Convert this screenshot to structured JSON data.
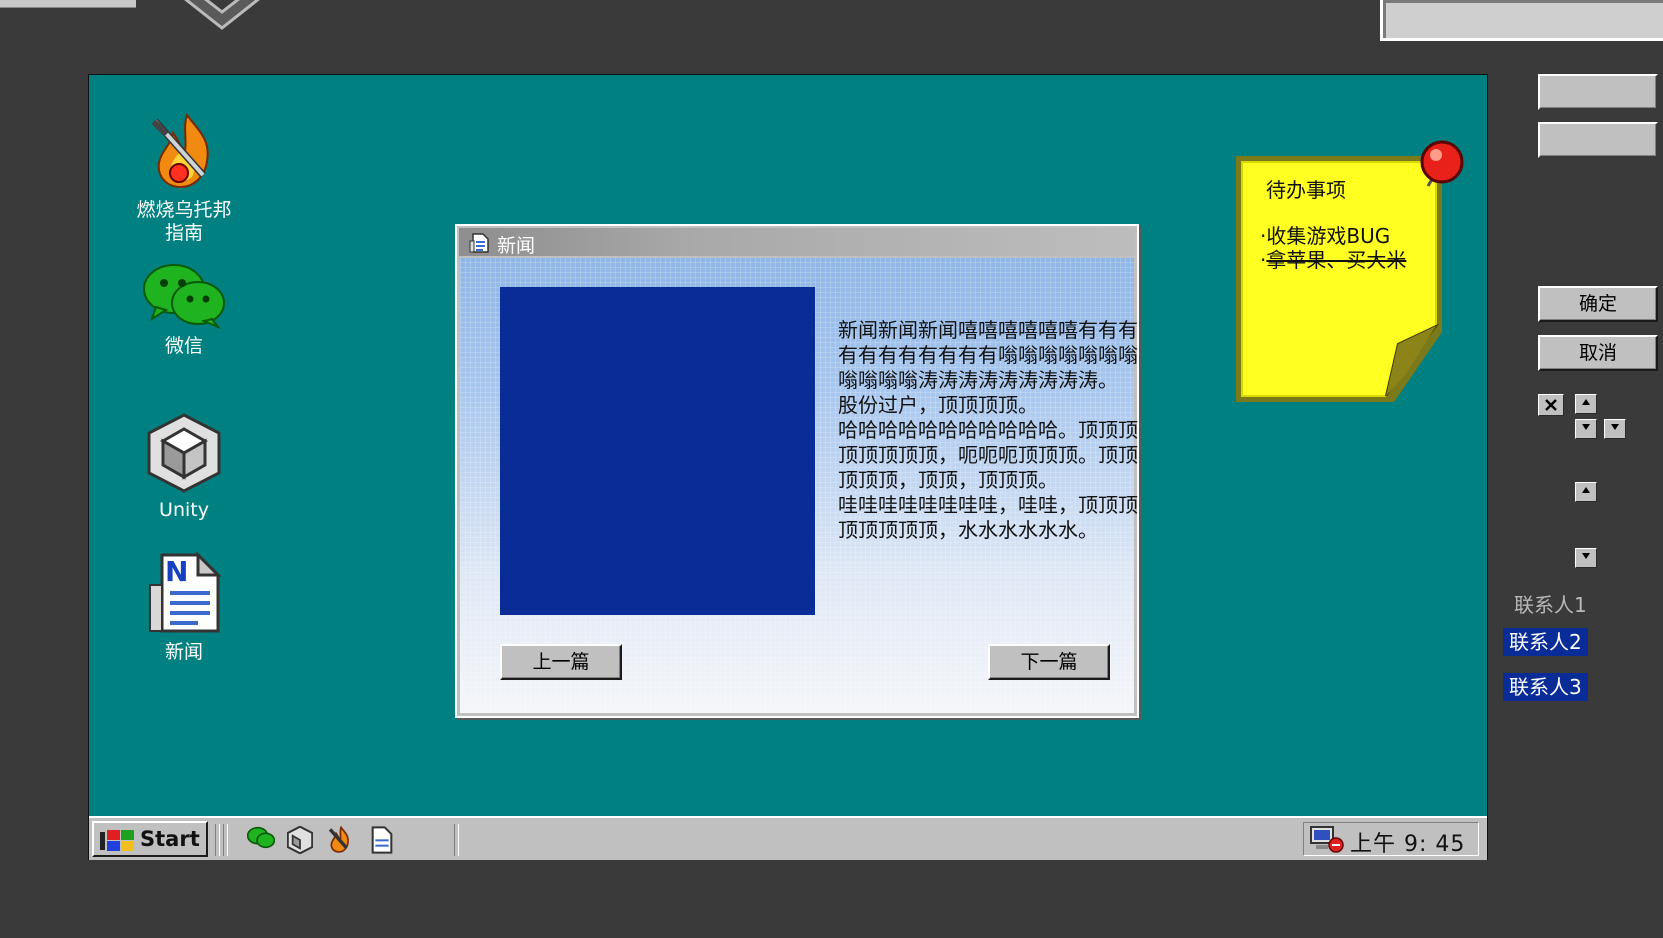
{
  "desktop": {
    "icons": [
      {
        "label_line1": "燃烧乌托邦",
        "label_line2": "指南",
        "icon": "burning-sword-icon"
      },
      {
        "label": "微信",
        "icon": "wechat-icon"
      },
      {
        "label": "Unity",
        "icon": "unity-icon"
      },
      {
        "label": "新闻",
        "icon": "news-document-icon"
      }
    ]
  },
  "news_window": {
    "title": "新闻",
    "paragraphs": [
      "新闻新闻新闻嘻嘻嘻嘻嘻嘻有有有有有有有有有有有嗡嗡嗡嗡嗡嗡嗡嗡嗡嗡嗡涛涛涛涛涛涛涛涛涛。",
      "股份过户，顶顶顶顶。",
      "哈哈哈哈哈哈哈哈哈哈哈。顶顶顶顶顶顶顶顶，呃呃呃顶顶顶。顶顶顶顶顶，顶顶，顶顶顶。",
      "哇哇哇哇哇哇哇哇，哇哇，顶顶顶顶顶顶顶顶，水水水水水水。"
    ],
    "prev_label": "上一篇",
    "next_label": "下一篇",
    "image_color": "#0a2c97"
  },
  "sticky_note": {
    "title": "待办事项",
    "items": [
      {
        "text": "收集游戏BUG",
        "done": false
      },
      {
        "text": "拿苹果、买大米",
        "done": true
      }
    ]
  },
  "taskbar": {
    "start_label": "Start",
    "pinned": [
      "wechat-icon",
      "unity-icon",
      "burning-sword-icon",
      "news-document-icon"
    ],
    "clock": "上午 9: 45"
  },
  "right_panel": {
    "confirm_label": "确定",
    "cancel_label": "取消",
    "contacts": [
      {
        "label": "联系人1",
        "selected": false
      },
      {
        "label": "联系人2",
        "selected": true
      },
      {
        "label": "联系人3",
        "selected": true
      }
    ]
  },
  "colors": {
    "desktop": "#008080",
    "background": "#3a3a3a",
    "window_face": "#c0c0c0",
    "selection": "#0a2c97",
    "sticky": "#ffff22"
  }
}
